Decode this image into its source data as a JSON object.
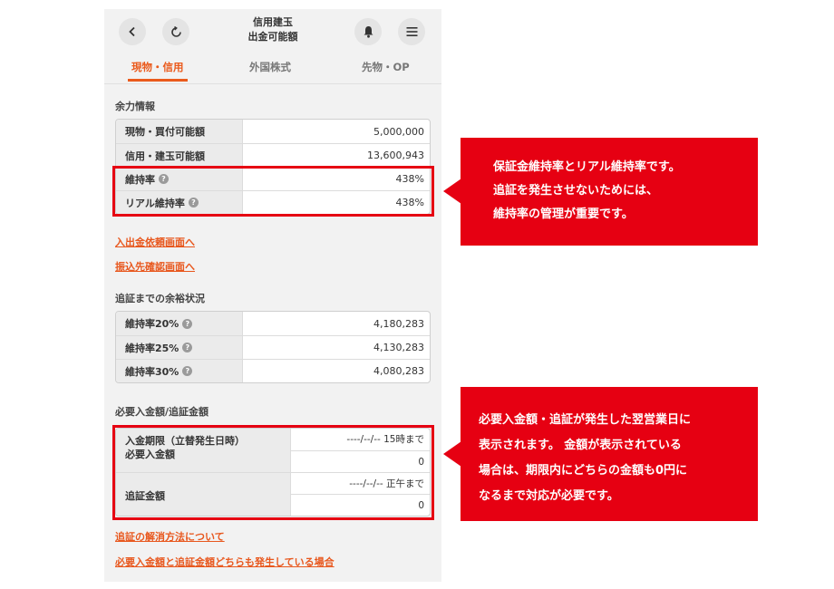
{
  "header": {
    "title_line1": "信用建玉",
    "title_line2": "出金可能額"
  },
  "tabs": [
    {
      "label": "現物・信用",
      "active": true
    },
    {
      "label": "外国株式",
      "active": false
    },
    {
      "label": "先物・OP",
      "active": false
    }
  ],
  "surplus": {
    "title": "余力情報",
    "rows": [
      {
        "label": "現物・買付可能額",
        "value": "5,000,000",
        "help": false
      },
      {
        "label": "信用・建玉可能額",
        "value": "13,600,943",
        "help": false
      },
      {
        "label": "維持率",
        "value": "438%",
        "help": true
      },
      {
        "label": "リアル維持率",
        "value": "438%",
        "help": true
      }
    ]
  },
  "links_a": [
    "入出金依頼画面へ",
    "振込先確認画面へ"
  ],
  "margin_status": {
    "title": "追証までの余裕状況",
    "rows": [
      {
        "label": "維持率20%",
        "value": "4,180,283"
      },
      {
        "label": "維持率25%",
        "value": "4,130,283"
      },
      {
        "label": "維持率30%",
        "value": "4,080,283"
      }
    ]
  },
  "required": {
    "title": "必要入金額/追証金額",
    "deposit_label_1": "入金期限（立替発生日時）",
    "deposit_label_2": "必要入金額",
    "deposit_deadline": "----/--/-- 15時まで",
    "deposit_amount": "0",
    "margin_label": "追証金額",
    "margin_deadline": "----/--/-- 正午まで",
    "margin_amount": "0"
  },
  "links_b": [
    "追証の解消方法について",
    "必要入金額と追証金額どちらも発生している場合"
  ],
  "callouts": {
    "first": [
      "保証金維持率とリアル維持率です。",
      "追証を発生させないためには、",
      "維持率の管理が重要です。"
    ],
    "second": [
      "必要入金額・追証が発生した翌営業日に",
      "表示されます。 金額が表示されている",
      "場合は、期限内にどちらの金額も0円に",
      "なるまで対応が必要です。"
    ]
  },
  "colors": {
    "accent": "#ea5a1c",
    "highlight": "#e60012"
  }
}
